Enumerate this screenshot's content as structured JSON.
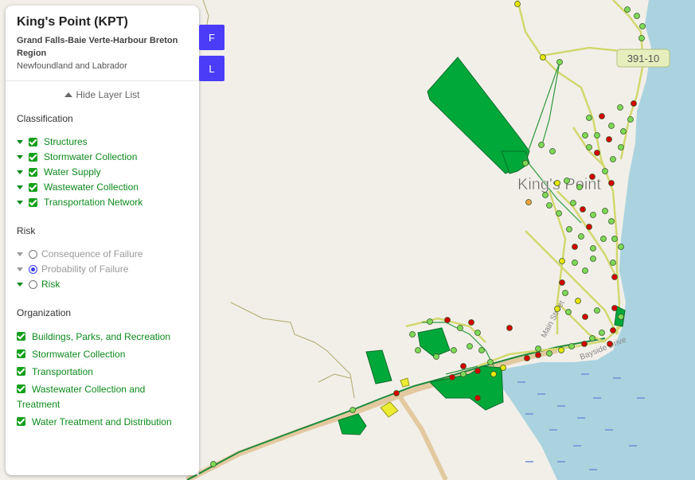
{
  "panel": {
    "title": "King's Point (KPT)",
    "subtitle": "Grand Falls-Baie Verte-Harbour Breton Region",
    "province": "Newfoundland and Labrador",
    "toggle_label": "Hide Layer List"
  },
  "classification": {
    "title": "Classification",
    "items": [
      "Structures",
      "Stormwater Collection",
      "Water Supply",
      "Wastewater Collection",
      "Transportation Network"
    ]
  },
  "risk": {
    "title": "Risk",
    "items": [
      {
        "label": "Consequence of Failure",
        "selected": false,
        "enabled": false
      },
      {
        "label": "Probability of Failure",
        "selected": true,
        "enabled": false
      },
      {
        "label": "Risk",
        "selected": false,
        "enabled": true
      }
    ]
  },
  "organization": {
    "title": "Organization",
    "items": [
      "Buildings, Parks, and Recreation",
      "Stormwater Collection",
      "Transportation",
      "Wastewater Collection and Treatment",
      "Water Treatment and Distribution"
    ]
  },
  "buttons": {
    "f": "F",
    "l": "L"
  },
  "map": {
    "place_label": "King's Point",
    "road_shield": "391-10",
    "road_label_1": "Main Street",
    "road_label_2": "Bayside Drive",
    "colors": {
      "land": "#f2efe9",
      "water": "#aad3df",
      "asset_green": "#00a83a",
      "pipe_yellow": "#d9e07a",
      "high": "#d40000",
      "medium": "#e6e600",
      "low": "#7ed957"
    }
  }
}
